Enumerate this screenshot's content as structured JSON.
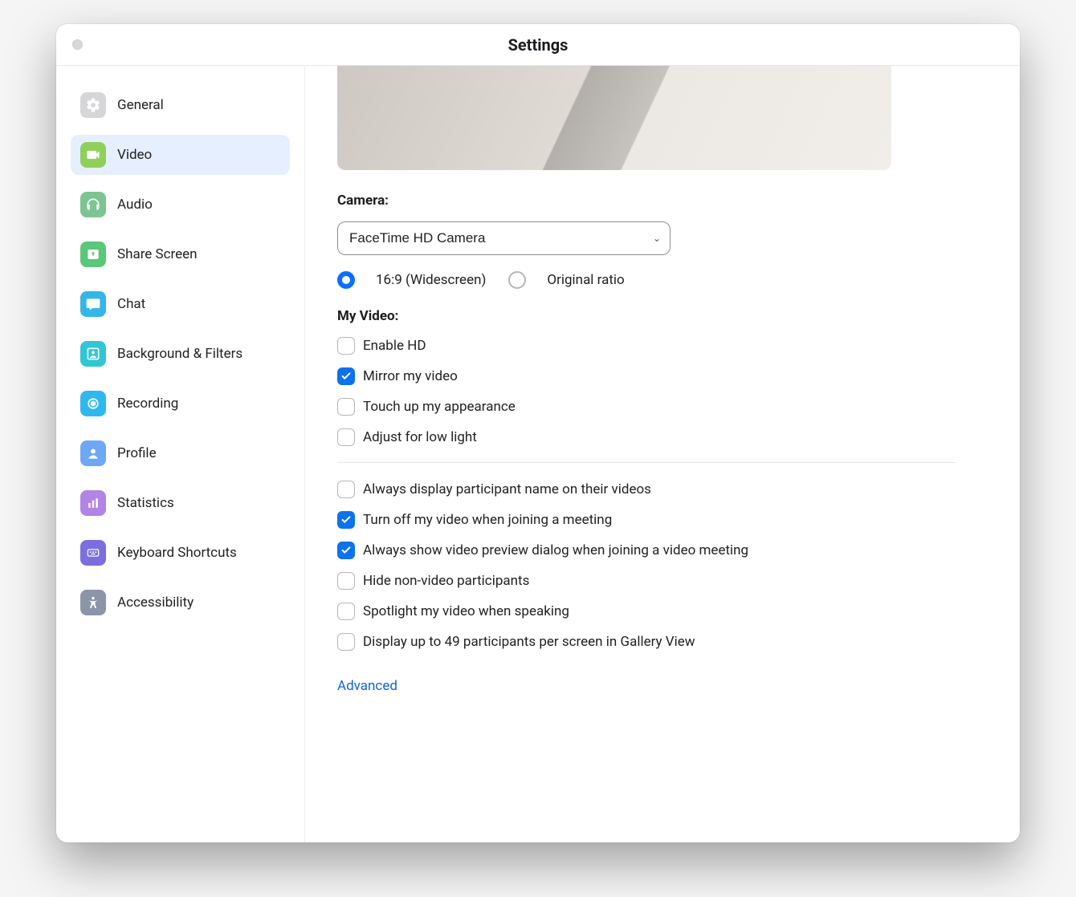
{
  "window": {
    "title": "Settings"
  },
  "sidebar": {
    "items": [
      {
        "label": "General"
      },
      {
        "label": "Video"
      },
      {
        "label": "Audio"
      },
      {
        "label": "Share Screen"
      },
      {
        "label": "Chat"
      },
      {
        "label": "Background & Filters"
      },
      {
        "label": "Recording"
      },
      {
        "label": "Profile"
      },
      {
        "label": "Statistics"
      },
      {
        "label": "Keyboard Shortcuts"
      },
      {
        "label": "Accessibility"
      }
    ],
    "active_index": 1
  },
  "video": {
    "camera_label": "Camera:",
    "camera_selected": "FaceTime HD Camera",
    "ratio": {
      "widescreen": "16:9 (Widescreen)",
      "original": "Original ratio",
      "selected": "widescreen"
    },
    "my_video_label": "My Video:",
    "my_video_opts": [
      {
        "label": "Enable HD",
        "checked": false
      },
      {
        "label": "Mirror my video",
        "checked": true
      },
      {
        "label": "Touch up my appearance",
        "checked": false
      },
      {
        "label": "Adjust for low light",
        "checked": false
      }
    ],
    "meeting_opts": [
      {
        "label": "Always display participant name on their videos",
        "checked": false
      },
      {
        "label": "Turn off my video when joining a meeting",
        "checked": true
      },
      {
        "label": "Always show video preview dialog when joining a video meeting",
        "checked": true
      },
      {
        "label": "Hide non-video participants",
        "checked": false
      },
      {
        "label": "Spotlight my video when speaking",
        "checked": false
      },
      {
        "label": "Display up to 49 participants per screen in Gallery View",
        "checked": false
      }
    ],
    "advanced_label": "Advanced"
  }
}
